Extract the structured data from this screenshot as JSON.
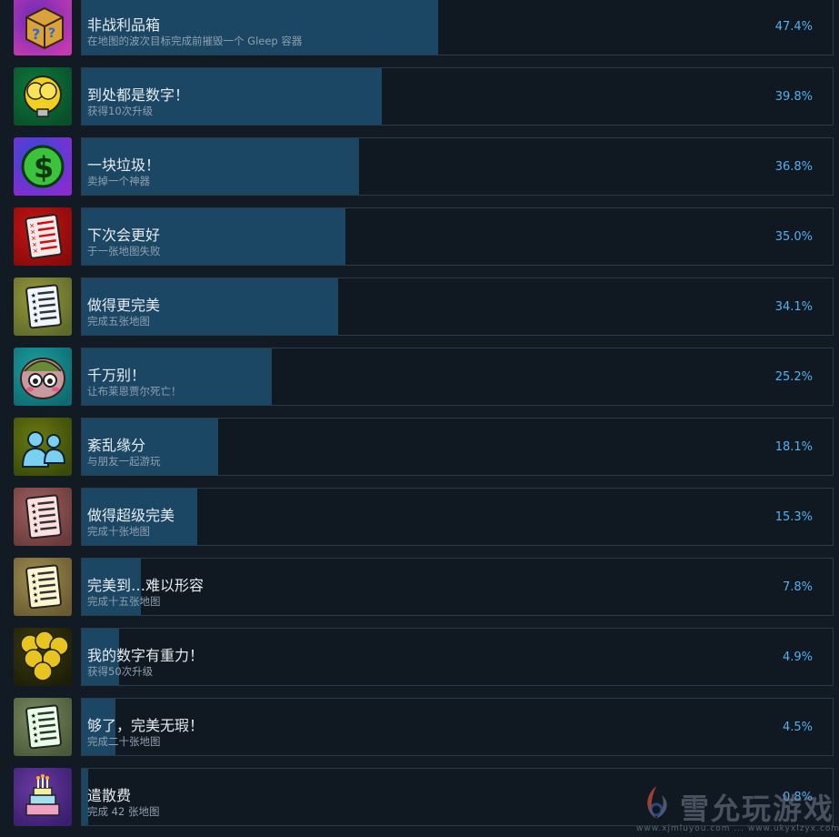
{
  "achievements": [
    {
      "title": "非战利品箱",
      "desc": "在地图的波次目标完成前摧毁一个 Gleep 容器",
      "percent_label": "47.4%",
      "percent": 47.4,
      "icon": "mystery-box-icon",
      "colors": [
        "#6a2bb8",
        "#c43ab0"
      ]
    },
    {
      "title": "到处都是数字！",
      "desc": "获得10次升级",
      "percent_label": "39.8%",
      "percent": 39.8,
      "icon": "lightbulb-icon",
      "colors": [
        "#0c7a3c",
        "#0a4e2a"
      ]
    },
    {
      "title": "一块垃圾！",
      "desc": "卖掉一个神器",
      "percent_label": "36.8%",
      "percent": 36.8,
      "icon": "dollar-coin-icon",
      "colors": [
        "#2d4bd8",
        "#8a2bd0"
      ]
    },
    {
      "title": "下次会更好",
      "desc": "于一张地图失败",
      "percent_label": "35.0%",
      "percent": 35.0,
      "icon": "failed-checklist-icon",
      "colors": [
        "#c41414",
        "#8a0a0a"
      ]
    },
    {
      "title": "做得更完美",
      "desc": "完成五张地图",
      "percent_label": "34.1%",
      "percent": 34.1,
      "icon": "checklist-icon",
      "colors": [
        "#9a9a3a",
        "#5e6a2a"
      ]
    },
    {
      "title": "千万别！",
      "desc": "让布莱恩贾尔死亡！",
      "percent_label": "25.2%",
      "percent": 25.2,
      "icon": "brain-monster-icon",
      "colors": [
        "#1aa0a0",
        "#0e6a70"
      ]
    },
    {
      "title": "紊乱缘分",
      "desc": "与朋友一起游玩",
      "percent_label": "18.1%",
      "percent": 18.1,
      "icon": "friends-icon",
      "colors": [
        "#6a7a10",
        "#3a4a08"
      ]
    },
    {
      "title": "做得超级完美",
      "desc": "完成十张地图",
      "percent_label": "15.3%",
      "percent": 15.3,
      "icon": "checklist-pink-icon",
      "colors": [
        "#a06060",
        "#6a3a3a"
      ]
    },
    {
      "title": "完美到…难以形容",
      "desc": "完成十五张地图",
      "percent_label": "7.8%",
      "percent": 7.8,
      "icon": "checklist-gold-icon",
      "colors": [
        "#a09050",
        "#6a5a30"
      ]
    },
    {
      "title": "我的数字有重力！",
      "desc": "获得50次升级",
      "percent_label": "4.9%",
      "percent": 4.9,
      "icon": "lightbulb-cluster-icon",
      "colors": [
        "#3a3a10",
        "#1e1e08"
      ]
    },
    {
      "title": "够了，完美无瑕！",
      "desc": "完成二十张地图",
      "percent_label": "4.5%",
      "percent": 4.5,
      "icon": "checklist-green-icon",
      "colors": [
        "#7a8a60",
        "#4a5a38"
      ]
    },
    {
      "title": "遣散费",
      "desc": "完成 42 张地图",
      "percent_label": "0.8%",
      "percent": 0.8,
      "icon": "cake-icon",
      "colors": [
        "#6a3aa0",
        "#3a1e70"
      ]
    }
  ],
  "watermark": {
    "brand": "雪允玩游戏",
    "url": "www.xjmluyou.com ... www.ukyxlzyx.com"
  }
}
